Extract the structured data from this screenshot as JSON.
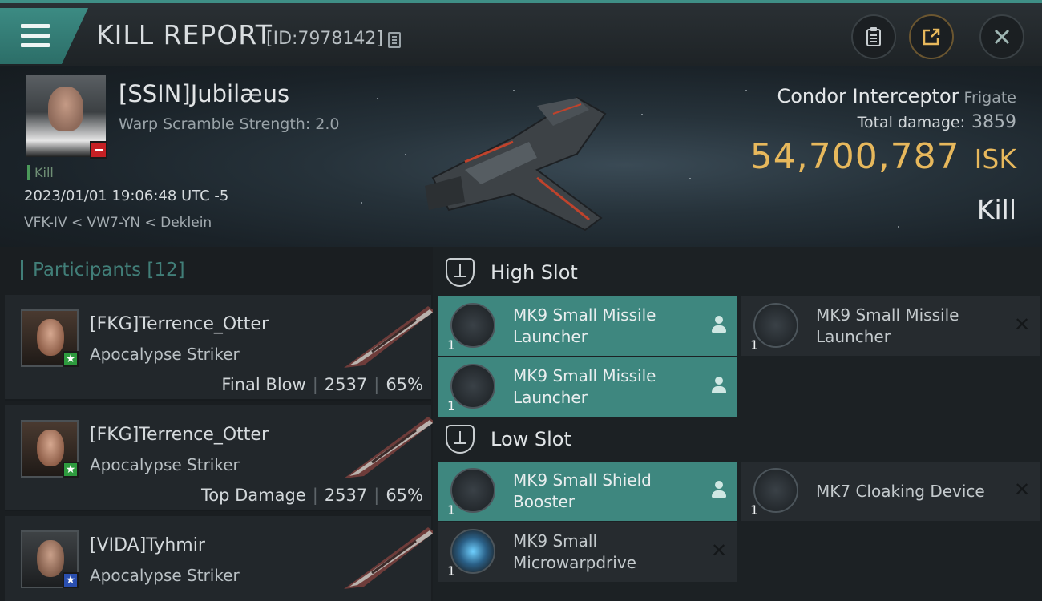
{
  "header": {
    "title": "KILL REPORT",
    "id_text": "[ID:7978142]"
  },
  "victim": {
    "name": "[SSIN]Jubilæus",
    "warp_scramble": "Warp Scramble Strength: 2.0",
    "tag": "Kill",
    "timestamp": "2023/01/01 19:06:48 UTC -5",
    "location": "VFK-IV < VW7-YN < Deklein",
    "ship_name": "Condor Interceptor",
    "ship_class": "Frigate",
    "total_damage_label": "Total damage:",
    "total_damage": "3859",
    "isk_value": "54,700,787",
    "isk_unit": "ISK",
    "result": "Kill"
  },
  "participants": {
    "heading": "Participants",
    "count": "[12]",
    "items": [
      {
        "name": "[FKG]Terrence_Otter",
        "ship": "Apocalypse Striker",
        "role": "Final Blow",
        "damage": "2537",
        "percent": "65%",
        "badge_color": "#2e9b3e"
      },
      {
        "name": "[FKG]Terrence_Otter",
        "ship": "Apocalypse Striker",
        "role": "Top Damage",
        "damage": "2537",
        "percent": "65%",
        "badge_color": "#2e9b3e"
      },
      {
        "name": "[VIDA]Tyhmir",
        "ship": "Apocalypse Striker",
        "role": "",
        "damage": "",
        "percent": "",
        "badge_color": "#2a4fb0"
      }
    ]
  },
  "fitting": {
    "high_slot_label": "High Slot",
    "low_slot_label": "Low Slot",
    "high": [
      {
        "name": "MK9 Small Missile Launcher",
        "qty": "1",
        "status": "dropped"
      },
      {
        "name": "MK9 Small Missile Launcher",
        "qty": "1",
        "status": "destroyed"
      },
      {
        "name": "MK9 Small Missile Launcher",
        "qty": "1",
        "status": "dropped"
      }
    ],
    "low": [
      {
        "name": "MK9 Small Shield Booster",
        "qty": "1",
        "status": "dropped"
      },
      {
        "name": "MK7 Cloaking Device",
        "qty": "1",
        "status": "destroyed"
      },
      {
        "name": "MK9 Small Microwarpdrive",
        "qty": "1",
        "status": "destroyed"
      }
    ]
  },
  "colors": {
    "accent": "#3f8f86",
    "isk": "#e7b85c",
    "dropped": "#3e877f",
    "destroyed": "#262b2f"
  }
}
